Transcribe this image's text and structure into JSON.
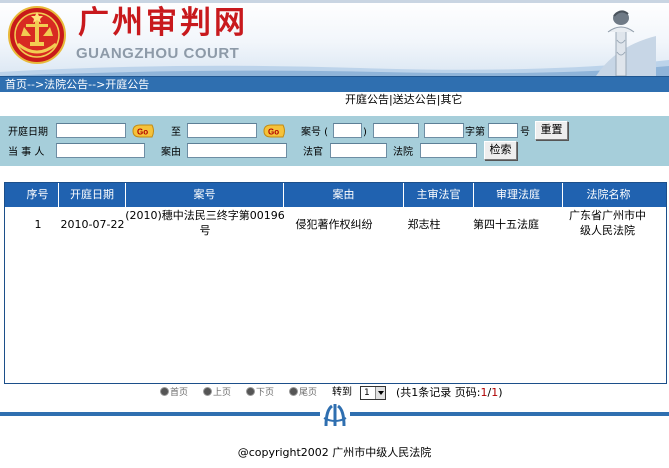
{
  "header": {
    "title": "广州审判网",
    "subtitle": "GUANGZHOU COURT"
  },
  "breadcrumb": "首页-->法院公告-->开庭公告",
  "sublinks": {
    "hearing": "开庭公告",
    "sep": "|",
    "service": "送达公告",
    "other": "其它"
  },
  "search": {
    "hearing_date_label": "开庭日期",
    "to_label": "至",
    "case_no_label": "案号 (",
    "case_no_paren": ")",
    "zi_di_label": "字第",
    "hao_label": "号",
    "reset_button": "重置",
    "party_label": "当 事 人",
    "cause_label": "案由",
    "judge_label": "法官",
    "court_label": "法院",
    "search_button": "检索",
    "go_label": "Go"
  },
  "table": {
    "columns": [
      "序号",
      "开庭日期",
      "案号",
      "案由",
      "主审法官",
      "审理法庭",
      "法院名称"
    ],
    "rows": [
      {
        "index": "1",
        "date": "2010-07-22",
        "case_no_line1": "(2010)穗中法民三终字第00196",
        "case_no_line2": "号",
        "cause": "侵犯著作权纠纷",
        "judge": "郑志柱",
        "courtroom": "第四十五法庭",
        "court_line1": "广东省广州市中",
        "court_line2": "级人民法院"
      }
    ]
  },
  "pager": {
    "first": "首页",
    "prev": "上页",
    "next": "下页",
    "last": "尾页",
    "goto_label": "转到",
    "goto_value": "1",
    "summary_prefix": "(共1条记录  页码:",
    "current_page": "1",
    "page_sep": "/",
    "total_pages": "1",
    "summary_suffix": ")"
  },
  "footer": {
    "copyright": "@copyright2002 广州市中级人民法院"
  },
  "colors": {
    "title_red": "#c8191d",
    "breadcrumb_blue": "#2f6fb0",
    "search_panel": "#a6ceda",
    "table_header": "#2062b0"
  }
}
